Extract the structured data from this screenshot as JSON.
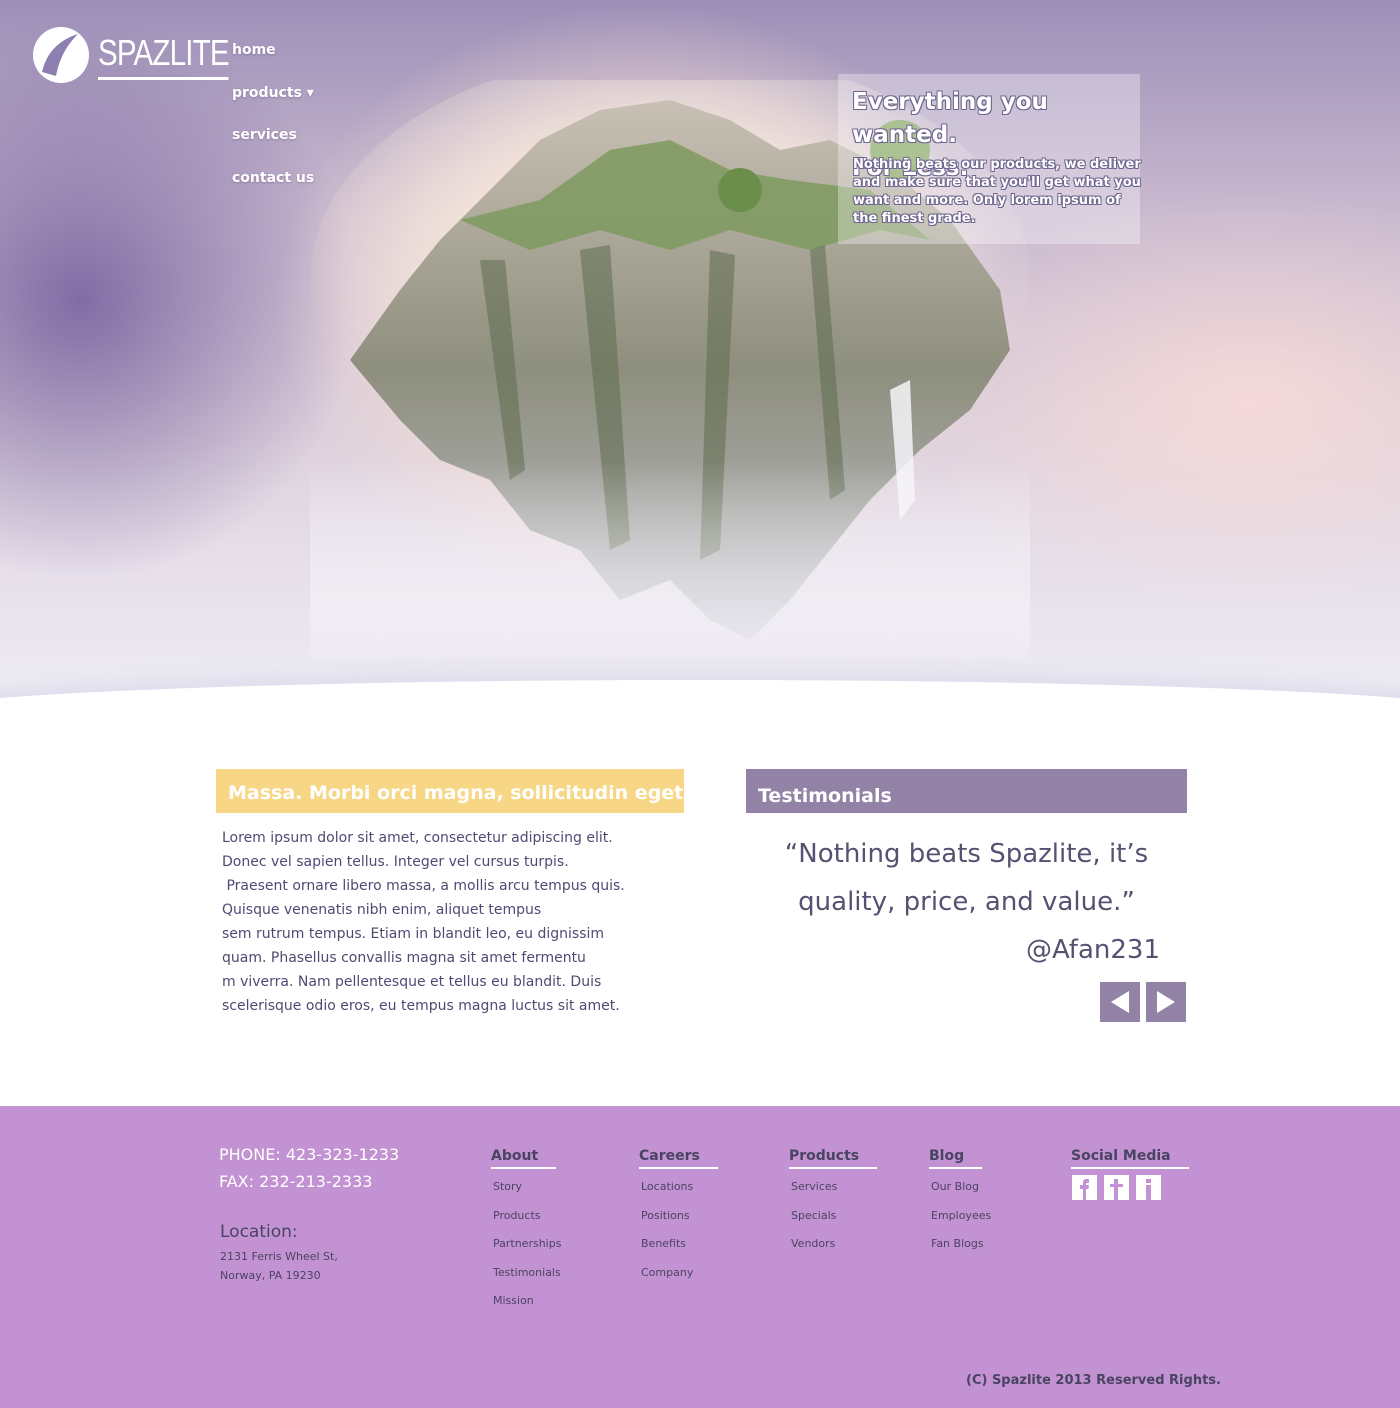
{
  "brand": {
    "name": "SPAZLITE"
  },
  "nav": {
    "items": [
      "home",
      "products ▾",
      "services",
      "contact us"
    ]
  },
  "hero": {
    "title_line1": "Everything you wanted.",
    "title_line2": "For Less.",
    "text": "Nothing beats our products, we deliver and make sure that you'll get what you want and more. Only lorem ipsum of the finest grade."
  },
  "intro": {
    "heading": "Massa. Morbi orci magna, sollicitudin eget.",
    "lines": [
      "Lorem ipsum dolor sit amet, consectetur adipiscing elit.",
      "Donec vel sapien tellus. Integer vel cursus turpis.",
      " Praesent ornare libero massa, a mollis arcu tempus quis.",
      "Quisque venenatis nibh enim, aliquet tempus",
      "sem rutrum tempus. Etiam in blandit leo, eu dignissim",
      "quam. Phasellus convallis magna sit amet fermentu",
      "m viverra. Nam pellentesque et tellus eu blandit. Duis",
      "scelerisque odio eros, eu tempus magna luctus sit amet."
    ]
  },
  "testimonials": {
    "heading": "Testimonials",
    "quote_line1": "“Nothing beats Spazlite, it’s",
    "quote_line2": "quality, price, and value.”",
    "author": "@Afan231",
    "prev_icon": "arrow-left-icon",
    "next_icon": "arrow-right-icon"
  },
  "footer": {
    "phone": "PHONE: 423-323-1233",
    "fax": "FAX: 232-213-2333",
    "location_title": "Location:",
    "address_line1": "2131 Ferris Wheel St,",
    "address_line2": "Norway, PA 19230",
    "columns": [
      {
        "title": "About",
        "links": [
          "Story",
          "Products",
          "Partnerships",
          "Testimonials",
          "Mission"
        ]
      },
      {
        "title": "Careers",
        "links": [
          "Locations",
          "Positions",
          "Benefits",
          "Company"
        ]
      },
      {
        "title": "Products",
        "links": [
          "Services",
          "Specials",
          "Vendors"
        ]
      },
      {
        "title": "Blog",
        "links": [
          "Our Blog",
          "Employees",
          "Fan Blogs"
        ]
      }
    ],
    "social_title": "Social Media",
    "social_icons": [
      "facebook-icon",
      "twitter-icon",
      "info-icon"
    ],
    "copyright": "(C) Spazlite 2013 Reserved Rights."
  },
  "colors": {
    "accent_yellow": "#f7d685",
    "accent_purple": "#9283a6",
    "footer_bg": "#c292d2",
    "text": "#4f4a72"
  }
}
